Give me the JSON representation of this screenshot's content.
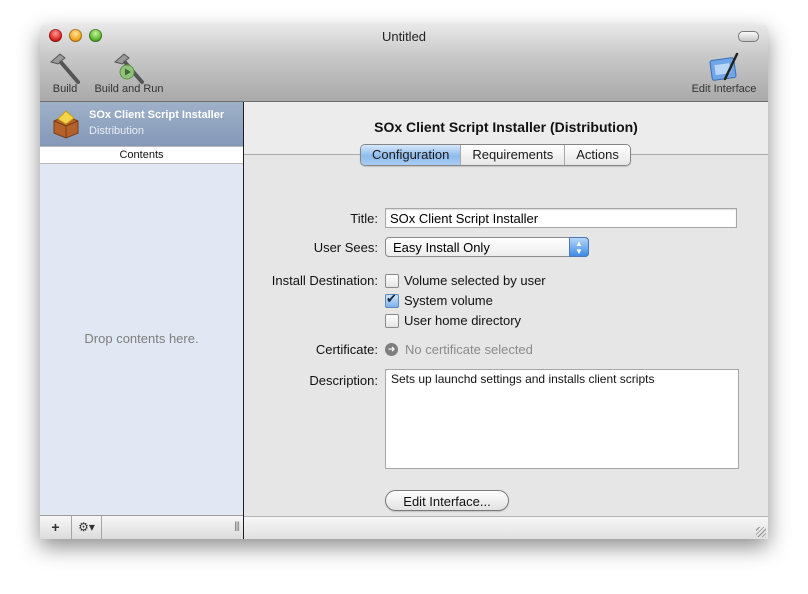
{
  "window": {
    "title": "Untitled"
  },
  "toolbar": {
    "build_label": "Build",
    "build_and_run_label": "Build and Run",
    "edit_interface_label": "Edit Interface",
    "icons": {
      "build": "hammer-icon",
      "build_and_run": "hammer-play-icon",
      "edit_interface": "interface-builder-icon"
    }
  },
  "sidebar": {
    "selected_item": {
      "title": "SOx Client Script Installer",
      "subtitle": "Distribution",
      "icon": "package-icon"
    },
    "contents_header": "Contents",
    "placeholder": "Drop contents here.",
    "footer": {
      "add_label": "+",
      "gear_label": "⚙▾",
      "grip": "|||"
    }
  },
  "main": {
    "title": "SOx Client Script Installer (Distribution)",
    "tabs": [
      {
        "label": "Configuration",
        "active": true
      },
      {
        "label": "Requirements",
        "active": false
      },
      {
        "label": "Actions",
        "active": false
      }
    ],
    "form": {
      "title_label": "Title:",
      "title_value": "SOx Client Script Installer",
      "user_sees_label": "User Sees:",
      "user_sees_value": "Easy Install Only",
      "install_destination_label": "Install Destination:",
      "destinations": [
        {
          "label": "Volume selected by user",
          "checked": false
        },
        {
          "label": "System volume",
          "checked": true
        },
        {
          "label": "User home directory",
          "checked": false
        }
      ],
      "certificate_label": "Certificate:",
      "certificate_value": "No certificate selected",
      "description_label": "Description:",
      "description_value": "Sets up launchd settings and installs client scripts",
      "edit_interface_button": "Edit Interface..."
    }
  },
  "colors": {
    "selection": "#8fa3c0",
    "sidebar_bg": "#e1e8f3",
    "tab_active": "#a9cdf3",
    "popup_arrow": "#3d8ae5"
  }
}
